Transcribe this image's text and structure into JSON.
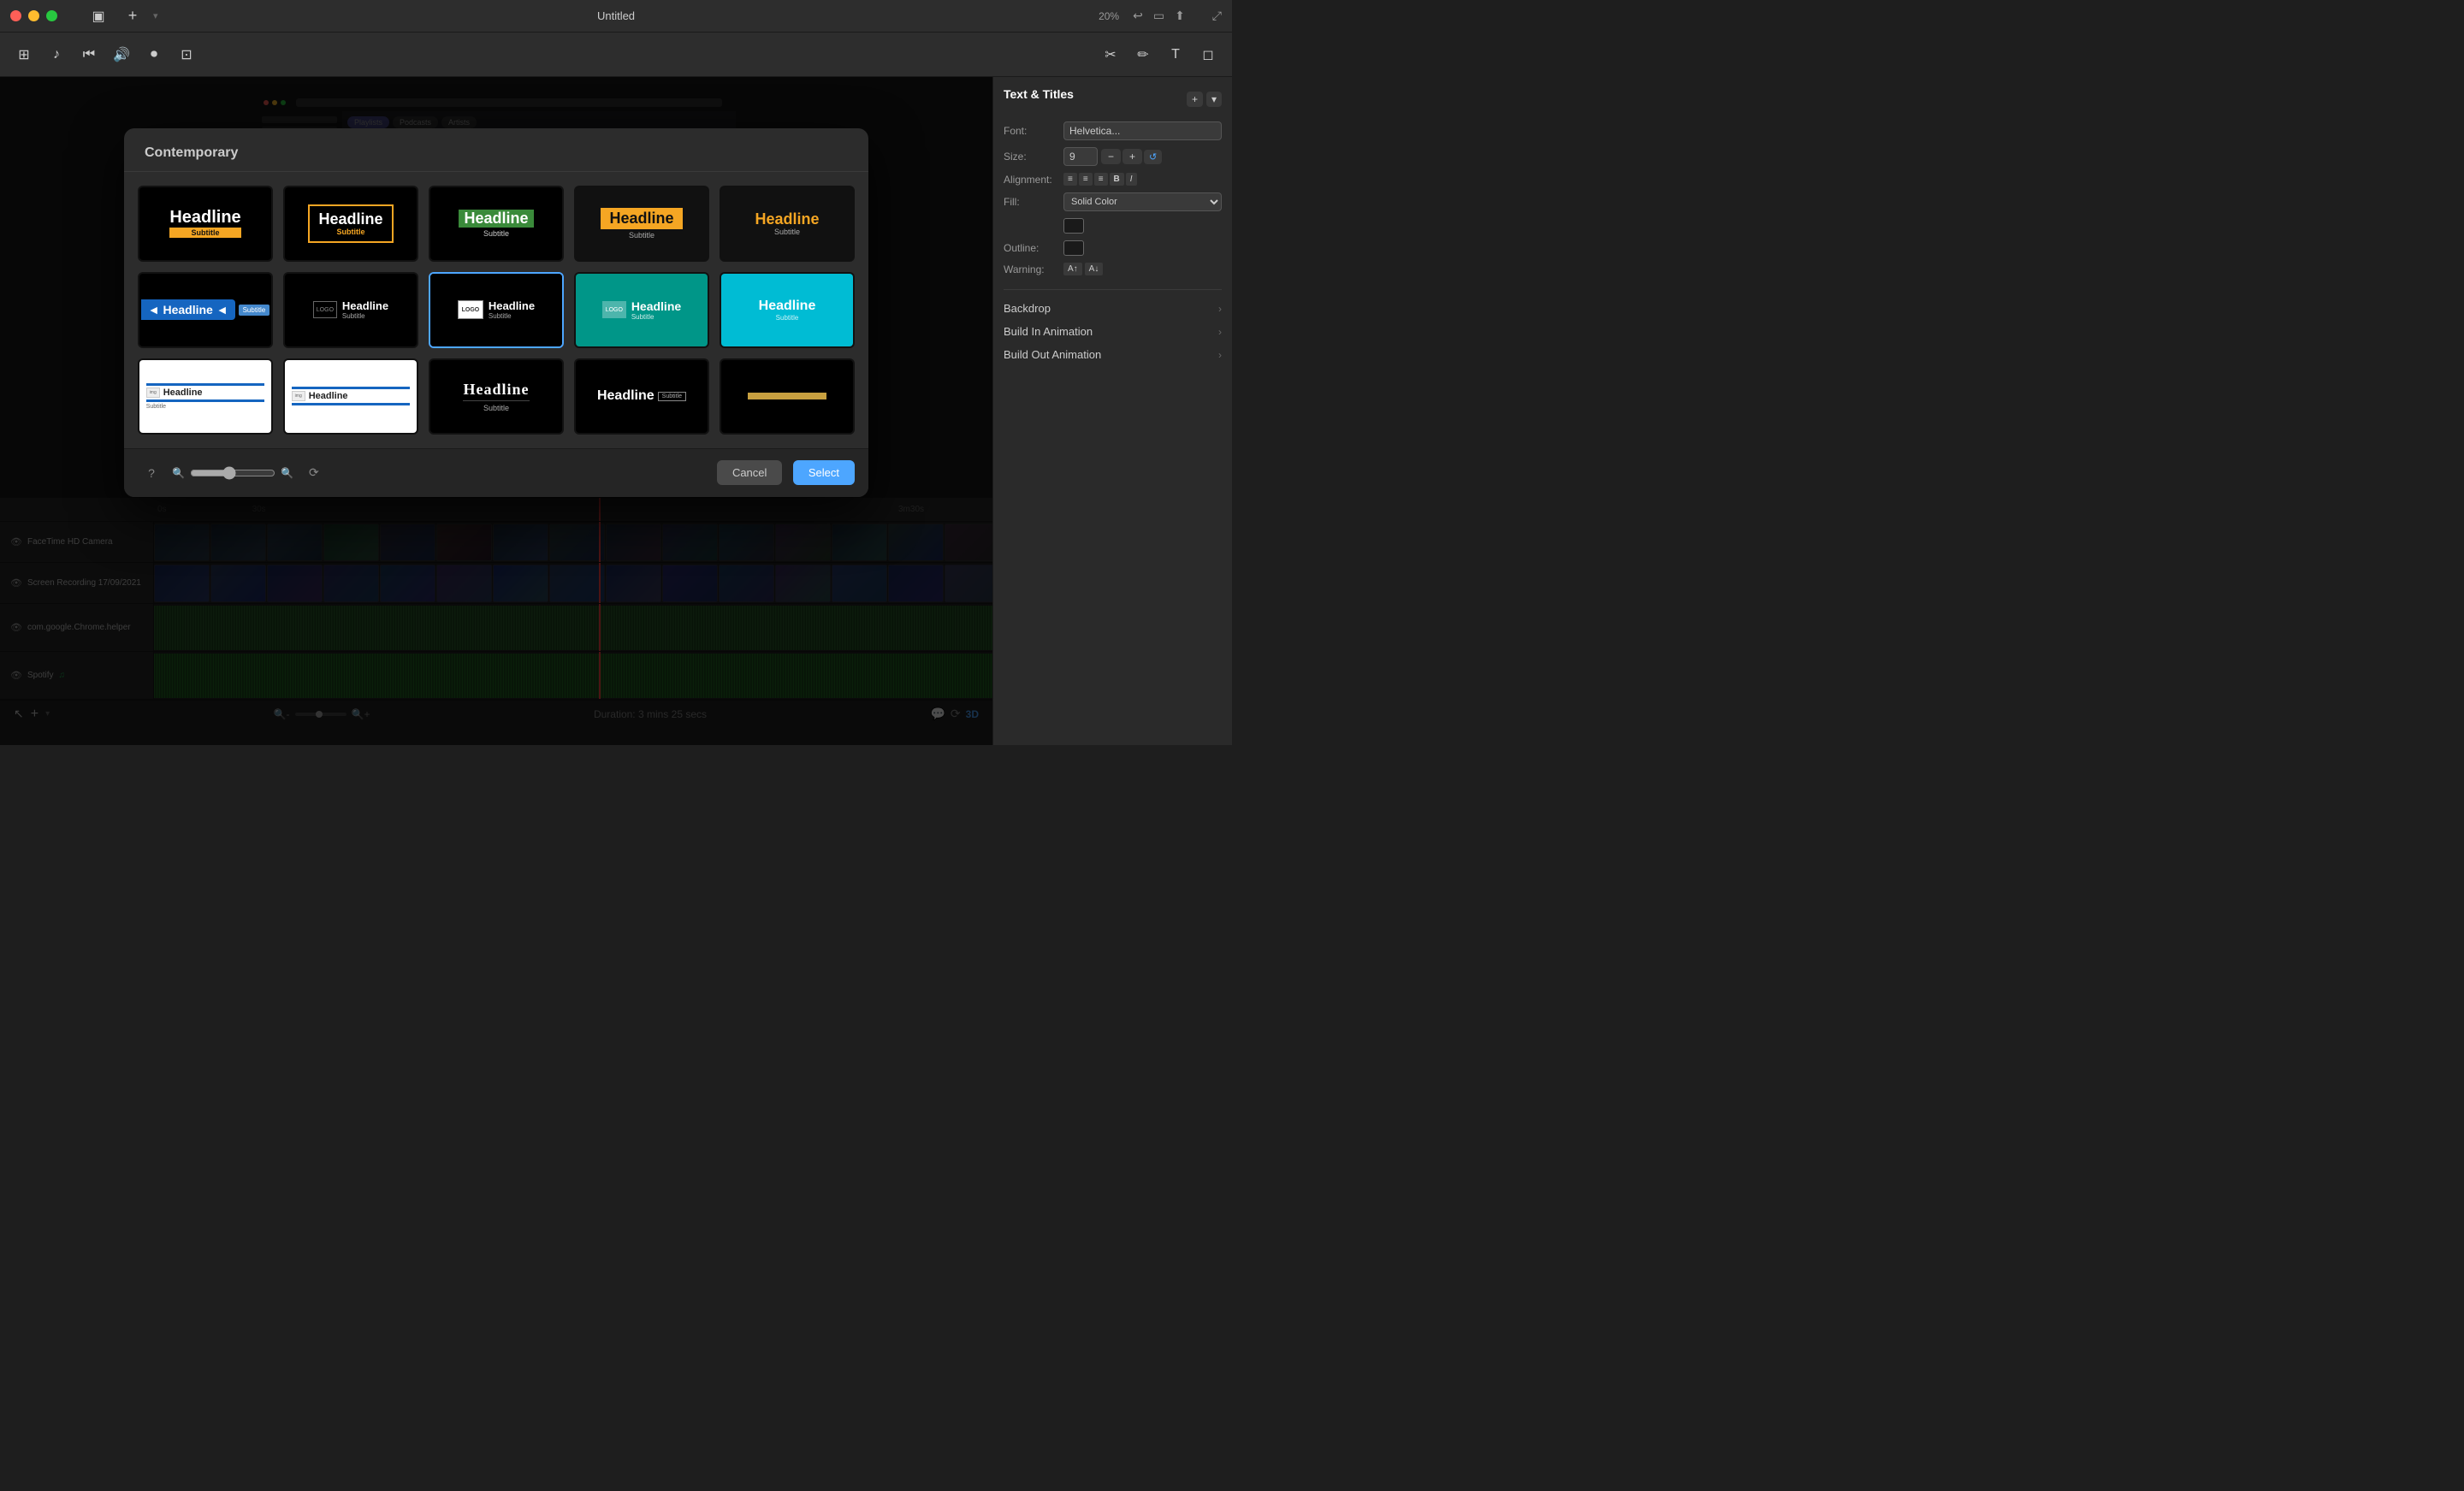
{
  "app": {
    "title": "Untitled",
    "zoom": "20%",
    "traffic_lights": [
      "red",
      "yellow",
      "green"
    ]
  },
  "toolbar": {
    "icons": [
      "sidebar",
      "add",
      "back",
      "share",
      "expand"
    ]
  },
  "right_panel": {
    "title": "Text & Titles",
    "font_label": "Font:",
    "font_value": "Helvetica...",
    "size_label": "Size:",
    "size_value": "9",
    "alignment_label": "Alignment:",
    "fill_label": "Fill:",
    "fill_value": "Solid Color",
    "outline_label": "Outline:",
    "warning_label": "Warning:",
    "backdrop_label": "Backdrop",
    "build_in_label": "Build In Animation",
    "build_out_label": "Build Out Animation"
  },
  "modal": {
    "category": "Contemporary",
    "templates": [
      {
        "id": 1,
        "style": "black-orange-bar",
        "selected": false
      },
      {
        "id": 2,
        "style": "black-yellow-outline",
        "selected": false
      },
      {
        "id": 3,
        "style": "black-green-stripe",
        "selected": false
      },
      {
        "id": 4,
        "style": "black-orange-bg",
        "selected": false
      },
      {
        "id": 5,
        "style": "orange-text",
        "selected": false
      },
      {
        "id": 6,
        "style": "blue-arrow",
        "selected": false
      },
      {
        "id": 7,
        "style": "black-logo-outline",
        "selected": false
      },
      {
        "id": 8,
        "style": "black-logo-selected",
        "selected": true
      },
      {
        "id": 9,
        "style": "teal-logo",
        "selected": false
      },
      {
        "id": 10,
        "style": "cyan-solid",
        "selected": false
      },
      {
        "id": 11,
        "style": "white-blue-bar",
        "selected": false
      },
      {
        "id": 12,
        "style": "white-blue-bar2",
        "selected": false
      },
      {
        "id": 13,
        "style": "black-headline-sub",
        "selected": false
      },
      {
        "id": 14,
        "style": "black-headline-box",
        "selected": false
      },
      {
        "id": 15,
        "style": "black-gold-bar",
        "selected": false
      }
    ],
    "cancel_label": "Cancel",
    "select_label": "Select"
  },
  "timeline": {
    "time_start": "0s",
    "time_mid": "30s",
    "time_end": "3m30s",
    "duration_label": "Duration: 3 mins 25 secs",
    "tracks": [
      {
        "name": "FaceTime HD Camera",
        "type": "video"
      },
      {
        "name": "Screen Recording 17/09/2021",
        "type": "video"
      },
      {
        "name": "com.google.Chrome.helper",
        "type": "audio"
      },
      {
        "name": "Spotify",
        "type": "audio"
      }
    ]
  }
}
